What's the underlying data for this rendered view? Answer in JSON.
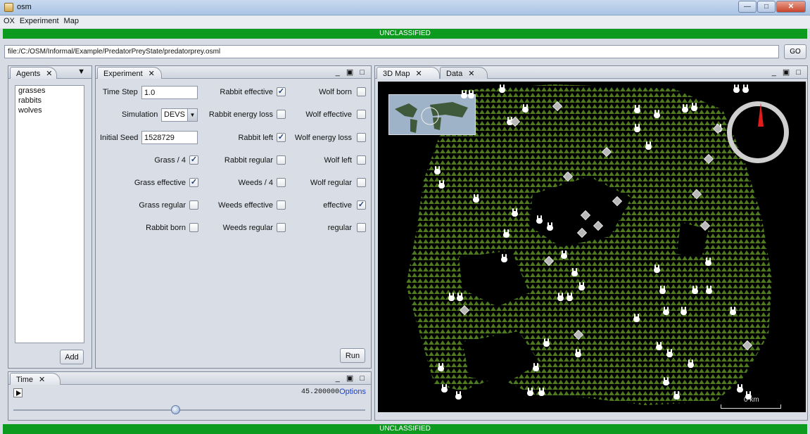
{
  "window": {
    "title": "osm"
  },
  "menu": [
    "OX",
    "Experiment",
    "Map"
  ],
  "banner": {
    "text": "UNCLASSIFIED",
    "color": "#0c9a1f"
  },
  "url_bar": {
    "value": "file:/C:/OSM/Informal/Example/PredatorPreyState/predatorprey.osml",
    "go_label": "GO"
  },
  "agents_panel": {
    "tab_label": "Agents",
    "items": [
      "grasses",
      "rabbits",
      "wolves"
    ],
    "add_label": "Add"
  },
  "experiment_panel": {
    "tab_label": "Experiment",
    "time_step_label": "Time Step",
    "time_step_value": "1.0",
    "simulation_label": "Simulation",
    "simulation_value": "DEVS",
    "initial_seed_label": "Initial Seed",
    "initial_seed_value": "1528729",
    "checkboxes": [
      {
        "label": "Grass / 4",
        "checked": true
      },
      {
        "label": "Grass effective",
        "checked": true
      },
      {
        "label": "Grass regular",
        "checked": false
      },
      {
        "label": "Rabbit born",
        "checked": false
      },
      {
        "label": "Rabbit effective",
        "checked": true
      },
      {
        "label": "Rabbit energy loss",
        "checked": false
      },
      {
        "label": "Rabbit left",
        "checked": true
      },
      {
        "label": "Rabbit regular",
        "checked": false
      },
      {
        "label": "Weeds / 4",
        "checked": false
      },
      {
        "label": "Weeds effective",
        "checked": false
      },
      {
        "label": "Weeds regular",
        "checked": false
      },
      {
        "label": "Wolf born",
        "checked": false
      },
      {
        "label": "Wolf effective",
        "checked": false
      },
      {
        "label": "Wolf energy loss",
        "checked": false
      },
      {
        "label": "Wolf left",
        "checked": false
      },
      {
        "label": "Wolf regular",
        "checked": false
      },
      {
        "label": "effective",
        "checked": true
      },
      {
        "label": "regular",
        "checked": false
      }
    ],
    "run_label": "Run"
  },
  "time_panel": {
    "tab_label": "Time",
    "value": "45.200000",
    "options_label": "Options",
    "slider_position": 0.46
  },
  "map_panel": {
    "tabs": [
      "3D Map",
      "Data"
    ],
    "active_tab": "3D Map",
    "scale_label": "0 km",
    "colors": {
      "background": "#000000",
      "grass": "#4d7a1f",
      "rabbit": "#ffffff",
      "wolf": "#b9b9b9",
      "compass_needle": "#e21b1b"
    }
  }
}
